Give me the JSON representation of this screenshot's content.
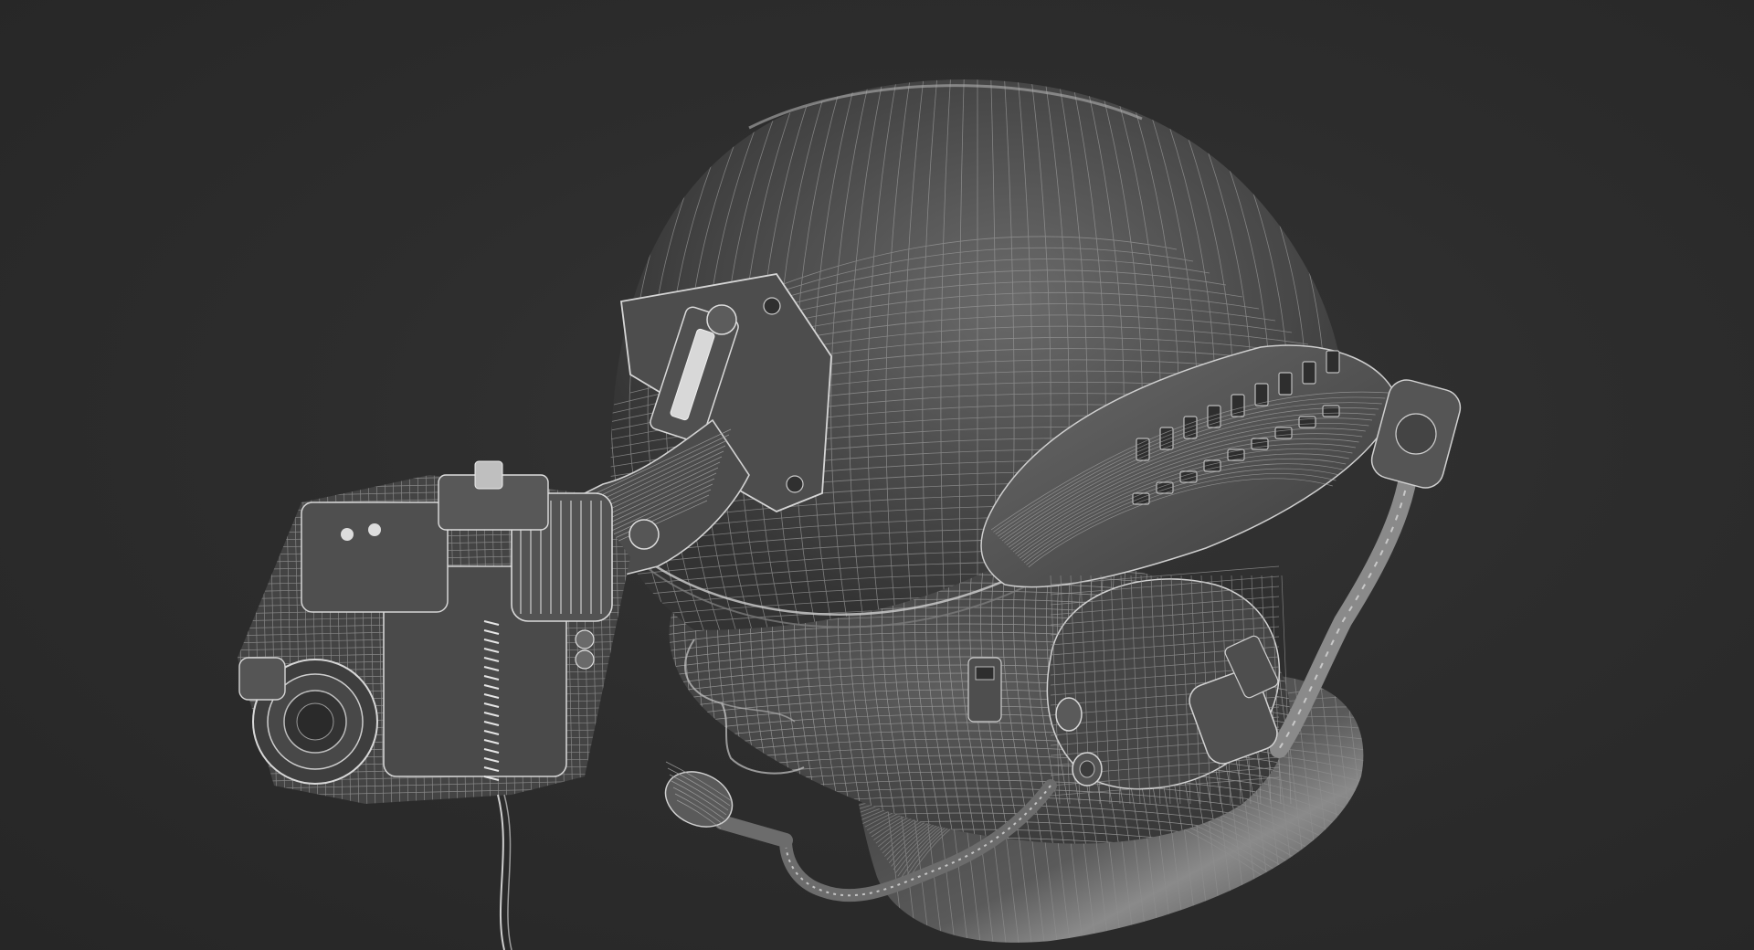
{
  "viewport": {
    "background_color": "#2b2b2b",
    "render_style": "wireframe-over-shaded"
  },
  "subject": {
    "icon": "helmet-with-night-vision-icon",
    "parts": [
      "helmet-shell",
      "head",
      "night-vision-goggle",
      "mount-arm",
      "side-rail",
      "ear-cup",
      "boom-microphone",
      "collar",
      "cable"
    ]
  },
  "colors": {
    "shell_base": "#4a4a4a",
    "shell_highlight": "#6e6e6e",
    "wire_line": "#9a9a9a",
    "wire_bright": "#d0d0d0",
    "metal": "#585858"
  }
}
